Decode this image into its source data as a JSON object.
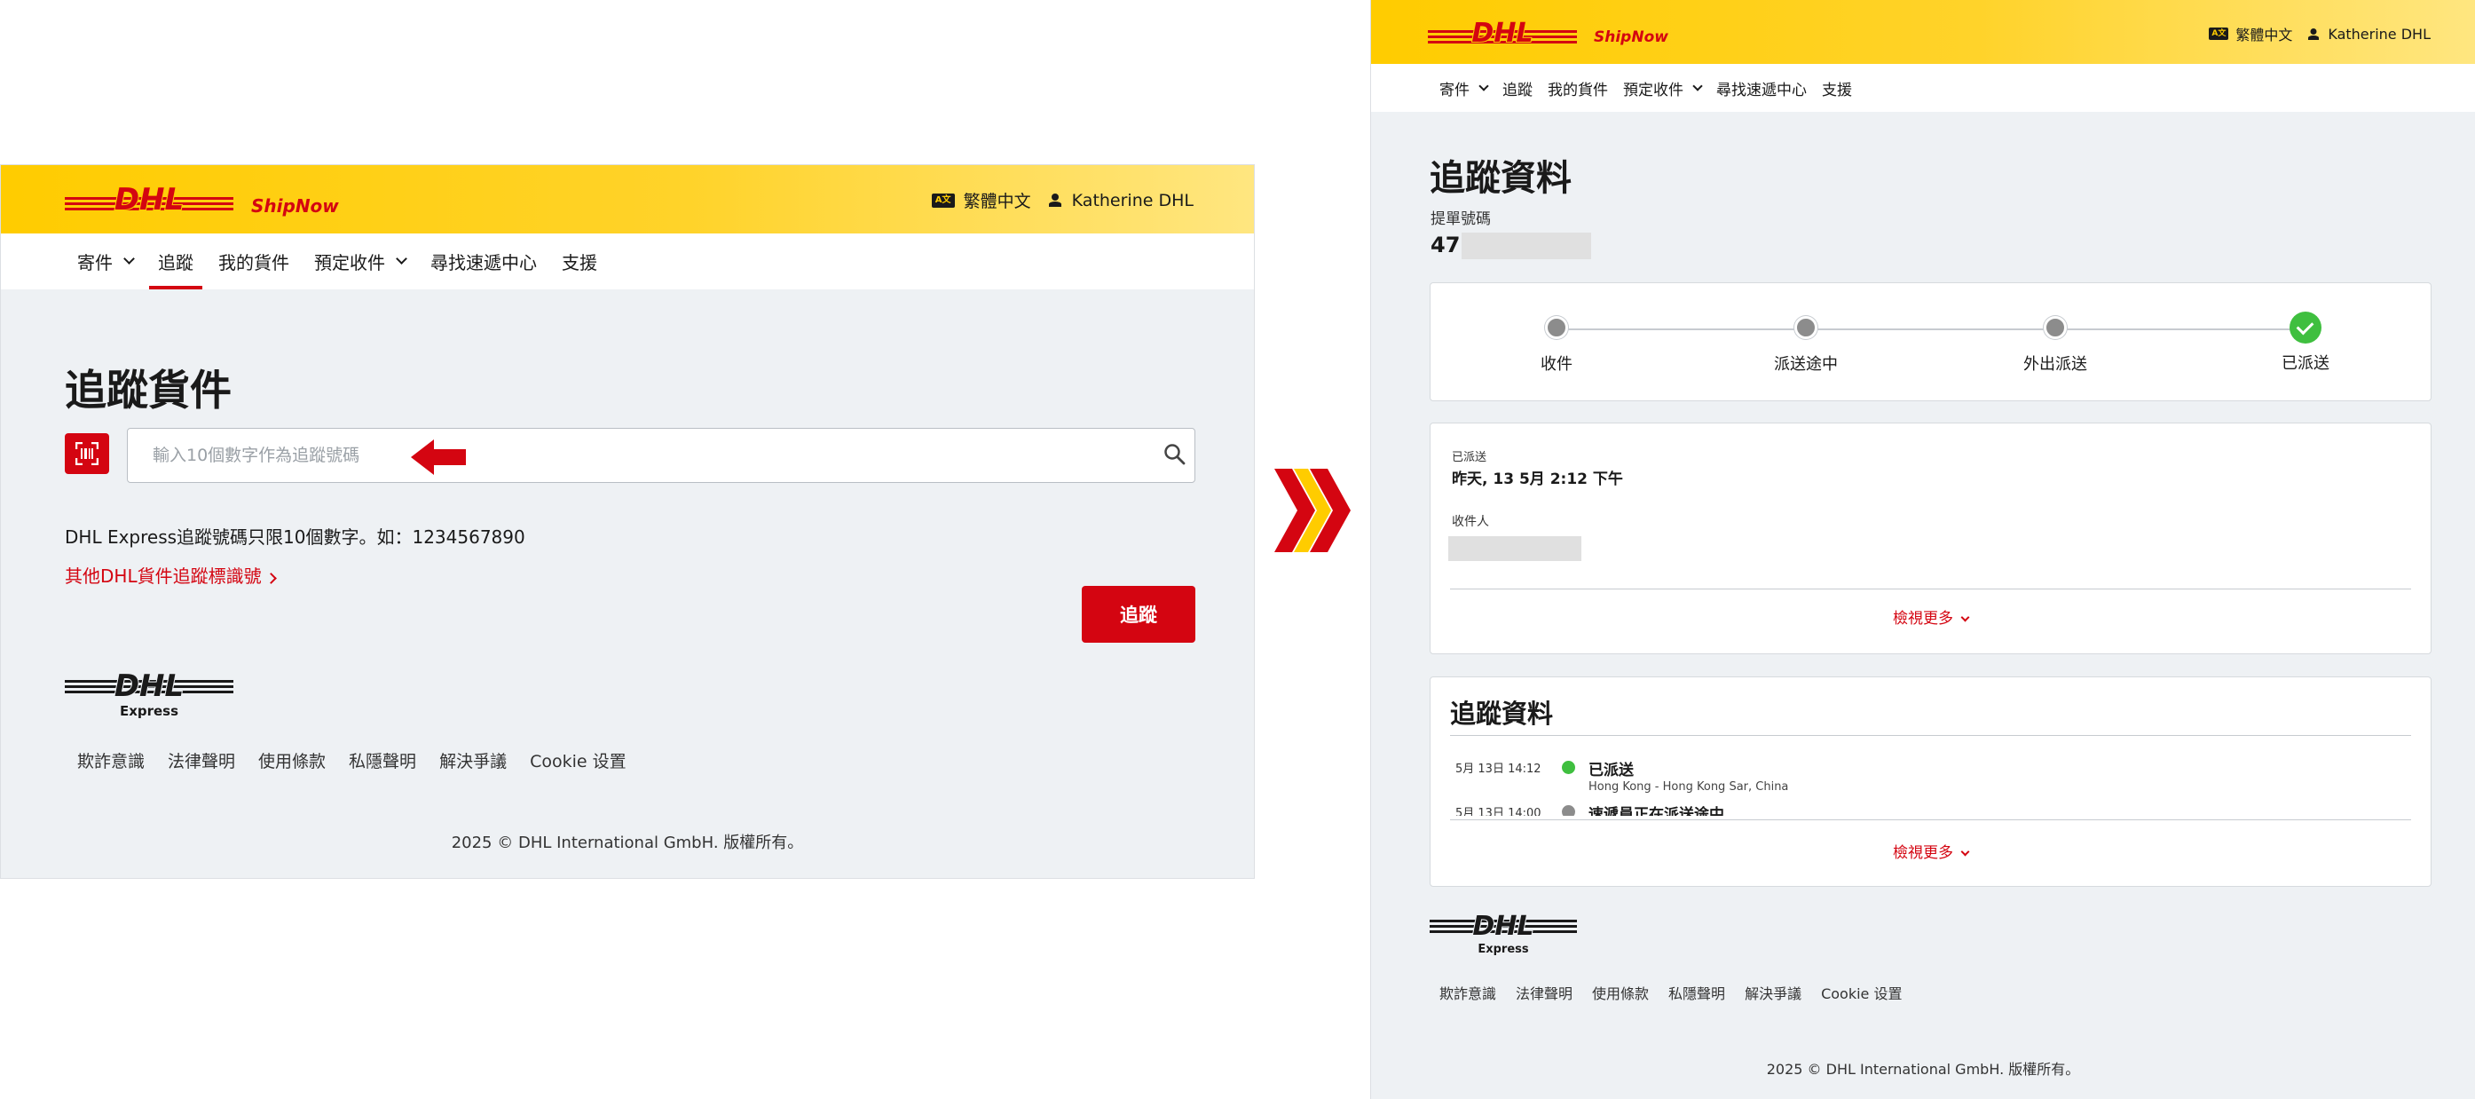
{
  "left": {
    "header": {
      "brand_logo": "DHL",
      "app_name": "ShipNow",
      "language": "繁體中文",
      "user": "Katherine DHL"
    },
    "nav": [
      {
        "label": "寄件",
        "has_dropdown": true
      },
      {
        "label": "追蹤",
        "active": true
      },
      {
        "label": "我的貨件"
      },
      {
        "label": "預定收件",
        "has_dropdown": true
      },
      {
        "label": "尋找速遞中心"
      },
      {
        "label": "支援"
      }
    ],
    "main": {
      "title": "追蹤貨件",
      "input_placeholder": "輸入10個數字作為追蹤號碼",
      "hint": "DHL Express追蹤號碼只限10個數字。如：1234567890",
      "other_link": "其他DHL貨件追蹤標識號",
      "track_button": "追蹤"
    },
    "footer": {
      "logo_text": "DHL",
      "logo_sub": "Express",
      "links": [
        "欺詐意識",
        "法律聲明",
        "使用條款",
        "私隱聲明",
        "解決爭議",
        "Cookie 设置"
      ],
      "copyright": "2025 © DHL International GmbH. 版權所有。"
    }
  },
  "right": {
    "header": {
      "brand_logo": "DHL",
      "app_name": "ShipNow",
      "language": "繁體中文",
      "user": "Katherine DHL"
    },
    "nav": [
      {
        "label": "寄件",
        "has_dropdown": true
      },
      {
        "label": "追蹤"
      },
      {
        "label": "我的貨件"
      },
      {
        "label": "預定收件",
        "has_dropdown": true
      },
      {
        "label": "尋找速遞中心"
      },
      {
        "label": "支援"
      }
    ],
    "detail": {
      "title": "追蹤資料",
      "waybill_label": "提單號碼",
      "waybill_visible": "47"
    },
    "progress": {
      "steps": [
        {
          "label": "收件",
          "done": false
        },
        {
          "label": "派送途中",
          "done": false
        },
        {
          "label": "外出派送",
          "done": false
        },
        {
          "label": "已派送",
          "done": true
        }
      ]
    },
    "info": {
      "status_label": "已派送",
      "status_time": "昨天, 13 5月 2:12 下午",
      "recipient_label": "收件人",
      "more": "檢視更多"
    },
    "events": {
      "title": "追蹤資料",
      "items": [
        {
          "date": "5月 13日 14:12",
          "status": "已派送",
          "location": "Hong Kong - Hong Kong Sar, China",
          "color": "#3fbf3f"
        },
        {
          "date": "5月 13日 14:00",
          "status": "速遞員正在派送途中",
          "location": "",
          "color": "#8c8c8c"
        }
      ],
      "more": "檢視更多"
    },
    "footer": {
      "logo_text": "DHL",
      "logo_sub": "Express",
      "links": [
        "欺詐意識",
        "法律聲明",
        "使用條款",
        "私隱聲明",
        "解決爭議",
        "Cookie 设置"
      ],
      "copyright": "2025 © DHL International GmbH. 版權所有。"
    }
  },
  "colors": {
    "dhl_red": "#d40511",
    "dhl_yellow": "#ffcc00",
    "delivered_green": "#3fbf3f",
    "pending_grey": "#8c8c8c"
  },
  "icons": {
    "language": "translate-icon",
    "user": "user-icon",
    "search": "search-icon",
    "scan": "barcode-scan-icon",
    "annotation": "red-arrow-icon",
    "transition": "chevron-right-icon"
  }
}
